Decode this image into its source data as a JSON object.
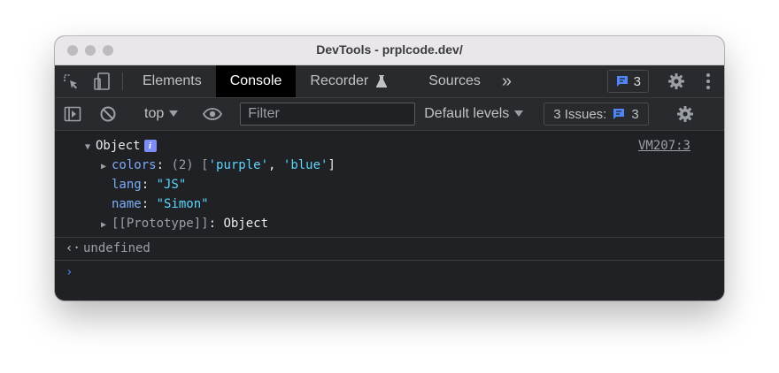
{
  "window": {
    "title": "DevTools - prplcode.dev/"
  },
  "tabs": [
    {
      "label": "Elements"
    },
    {
      "label": "Console"
    },
    {
      "label": "Recorder"
    },
    {
      "label": "Sources"
    }
  ],
  "tabbar": {
    "messages_count": "3",
    "more_symbol": "»"
  },
  "toolbar": {
    "context": "top",
    "filter_placeholder": "Filter",
    "levels": "Default levels",
    "issues_label": "3 Issues:",
    "issues_count": "3"
  },
  "console": {
    "object_label": "Object",
    "source": "VM207:3",
    "props": [
      {
        "key": "colors",
        "value_prefix": "(2) [",
        "value_parts": [
          "'purple'",
          "'blue'"
        ]
      },
      {
        "key": "lang",
        "value": "\"JS\""
      },
      {
        "key": "name",
        "value": "\"Simon\""
      },
      {
        "key": "[[Prototype]]",
        "value": "Object"
      }
    ],
    "result": "undefined",
    "prompt_symbol": "›"
  },
  "colors": {
    "accent": "#7cacf8",
    "string": "#5cd5fb",
    "badge": "#4f86f7"
  }
}
